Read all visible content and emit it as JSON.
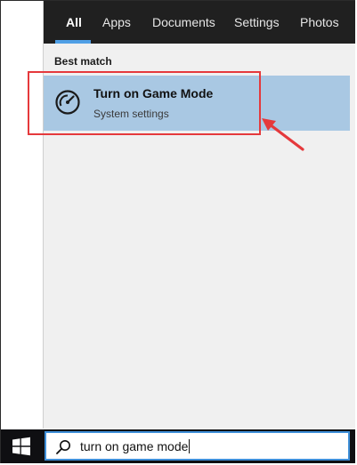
{
  "tabs": [
    {
      "label": "All",
      "active": true
    },
    {
      "label": "Apps"
    },
    {
      "label": "Documents"
    },
    {
      "label": "Settings"
    },
    {
      "label": "Photos"
    }
  ],
  "results": {
    "section_header": "Best match",
    "best_match": {
      "icon": "speedometer-icon",
      "title": "Turn on Game Mode",
      "subtitle": "System settings"
    }
  },
  "taskbar": {
    "start_icon": "windows-logo-icon",
    "search_icon": "search-icon",
    "search_value": "turn on game mode"
  },
  "colors": {
    "accent": "#4f9fe6",
    "selection": "#a9c8e3",
    "annotation": "#e5393c",
    "top_bar": "#202020",
    "taskbar": "#0f0f12"
  }
}
